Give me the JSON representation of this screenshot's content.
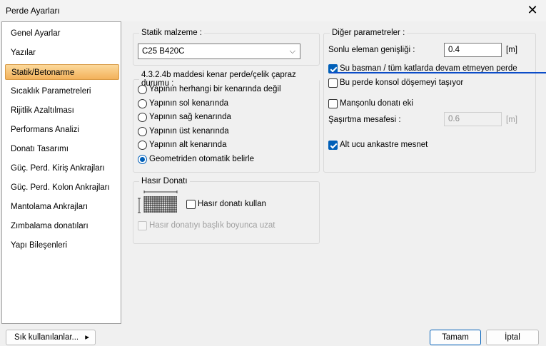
{
  "window": {
    "title": "Perde Ayarları",
    "close_glyph": "✕"
  },
  "sidebar": {
    "items": [
      {
        "label": "Genel Ayarlar"
      },
      {
        "label": "Yazılar"
      },
      {
        "label": "Statik/Betonarme",
        "active": true
      },
      {
        "label": "Sıcaklık Parametreleri"
      },
      {
        "label": "Rijitlik Azaltılması"
      },
      {
        "label": "Performans Analizi"
      },
      {
        "label": "Donatı Tasarımı"
      },
      {
        "label": "Güç. Perd. Kiriş Ankrajları"
      },
      {
        "label": "Güç. Perd. Kolon Ankrajları"
      },
      {
        "label": "Mantolama Ankrajları"
      },
      {
        "label": "Zımbalama donatıları"
      },
      {
        "label": "Yapı Bileşenleri"
      }
    ]
  },
  "static_material": {
    "legend": "Statik malzeme :",
    "selected": "C25 B420C"
  },
  "edge_condition": {
    "legend": "4.3.2.4b maddesi kenar perde/çelik çapraz durumu :",
    "options": [
      {
        "label": "Yapının herhangi bir kenarında değil",
        "checked": false
      },
      {
        "label": "Yapının sol kenarında",
        "checked": false
      },
      {
        "label": "Yapının sağ kenarında",
        "checked": false
      },
      {
        "label": "Yapının üst kenarında",
        "checked": false
      },
      {
        "label": "Yapının alt kenarında",
        "checked": false
      },
      {
        "label": "Geometriden otomatik belirle",
        "checked": true
      }
    ]
  },
  "mesh": {
    "legend": "Hasır Donatı",
    "use_label": "Hasır donatı kullan",
    "use_checked": false,
    "extend_label": "Hasır donatıyı başlık boyunca uzat",
    "extend_checked": false,
    "icon": "mesh-reinforcement-icon"
  },
  "other": {
    "legend": "Diğer parametreler :",
    "element_width_label": "Sonlu eleman genişliği :",
    "element_width_value": "0.4",
    "element_width_unit": "[m]",
    "basement_label": "Su basman / tüm katlarda devam etmeyen perde",
    "basement_checked": true,
    "console_label": "Bu perde konsol döşemeyi taşıyor",
    "console_checked": false,
    "splice_label": "Manşonlu donatı eki",
    "splice_checked": false,
    "offset_label": "Şaşırtma mesafesi :",
    "offset_value": "0.6",
    "offset_unit": "[m]",
    "fixed_label": "Alt ucu ankastre mesnet",
    "fixed_checked": true
  },
  "footer": {
    "favorites_label": "Sık kullanılanlar...",
    "favorites_arrow": "▸",
    "ok_label": "Tamam",
    "cancel_label": "İptal"
  },
  "colors": {
    "accent": "#005fb8",
    "active_item": "#f3b15a",
    "focus_line": "#0b4cc8"
  }
}
